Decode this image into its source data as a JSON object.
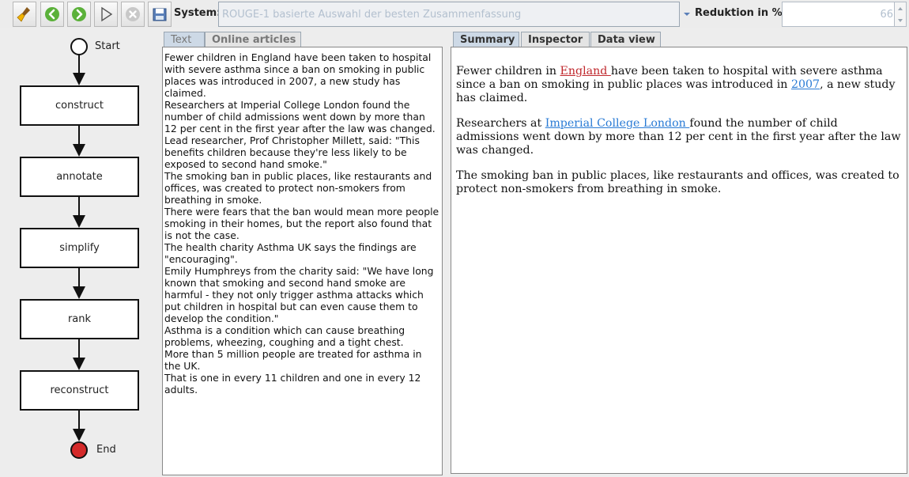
{
  "toolbar": {
    "buttons": [
      {
        "name": "clear-icon"
      },
      {
        "name": "back-arrow-icon"
      },
      {
        "name": "forward-arrow-icon"
      },
      {
        "name": "run-icon"
      },
      {
        "name": "stop-icon"
      },
      {
        "name": "load-icon"
      }
    ],
    "system_label": "System:",
    "system_value": "ROUGE-1 basierte Auswahl der besten Zusammenfassung",
    "reduction_label": "Reduktion in %:",
    "reduction_value": "66"
  },
  "workflow": {
    "start_label": "Start",
    "end_label": "End",
    "steps": [
      "construct",
      "annotate",
      "simplify",
      "rank",
      "reconstruct"
    ],
    "start_color": "#ffffff",
    "end_color": "#d42a2a"
  },
  "left_tabs": [
    "Text",
    "Online articles"
  ],
  "right_tabs": [
    "Summary",
    "Inspector",
    "Data view"
  ],
  "article_lines": [
    "Fewer children in England have been taken to hospital with severe asthma since a ban on smoking in public places was introduced in 2007, a new study has claimed.",
    "Researchers at Imperial College London found the number of child admissions went down by more than 12 per cent in the first year after the law was changed.",
    "Lead researcher, Prof Christopher Millett, said: \"This benefits children because they're less likely to be exposed to second hand smoke.\"",
    "The smoking ban in public places, like restaurants and offices, was created to protect non-smokers from breathing in smoke.",
    "There were fears that the ban would mean more people smoking in their homes, but the report also found that is not the case.",
    "The health charity Asthma UK says the findings are \"encouraging\".",
    "Emily Humphreys from the charity said: \"We have long known that smoking and second hand smoke are harmful - they not only trigger asthma attacks which put children in hospital but can even cause them to develop the condition.\"",
    "Asthma is a condition which can cause breathing problems, wheezing, coughing and a tight chest.",
    "More than 5 million people are treated for asthma in the UK.",
    "That is one in every 11 children and one in every 12 adults."
  ],
  "summary": {
    "p1_a": "Fewer children in ",
    "p1_entity1": "England ",
    "p1_b": "have been taken to hospital with severe asthma since a ban on smoking in public places was introduced in ",
    "p1_entity2": "2007",
    "p1_c": ", a new study has claimed.",
    "p2_a": "Researchers at ",
    "p2_entity": "Imperial College London ",
    "p2_b": "found the number of child admissions went down by more than 12 per cent in the first year after the law was changed.",
    "p3": "The smoking ban in public places, like restaurants and offices, was created to protect non-smokers from breathing in smoke.",
    "entity_colors": {
      "location": "#c0282d",
      "other": "#2a7bd5"
    }
  }
}
